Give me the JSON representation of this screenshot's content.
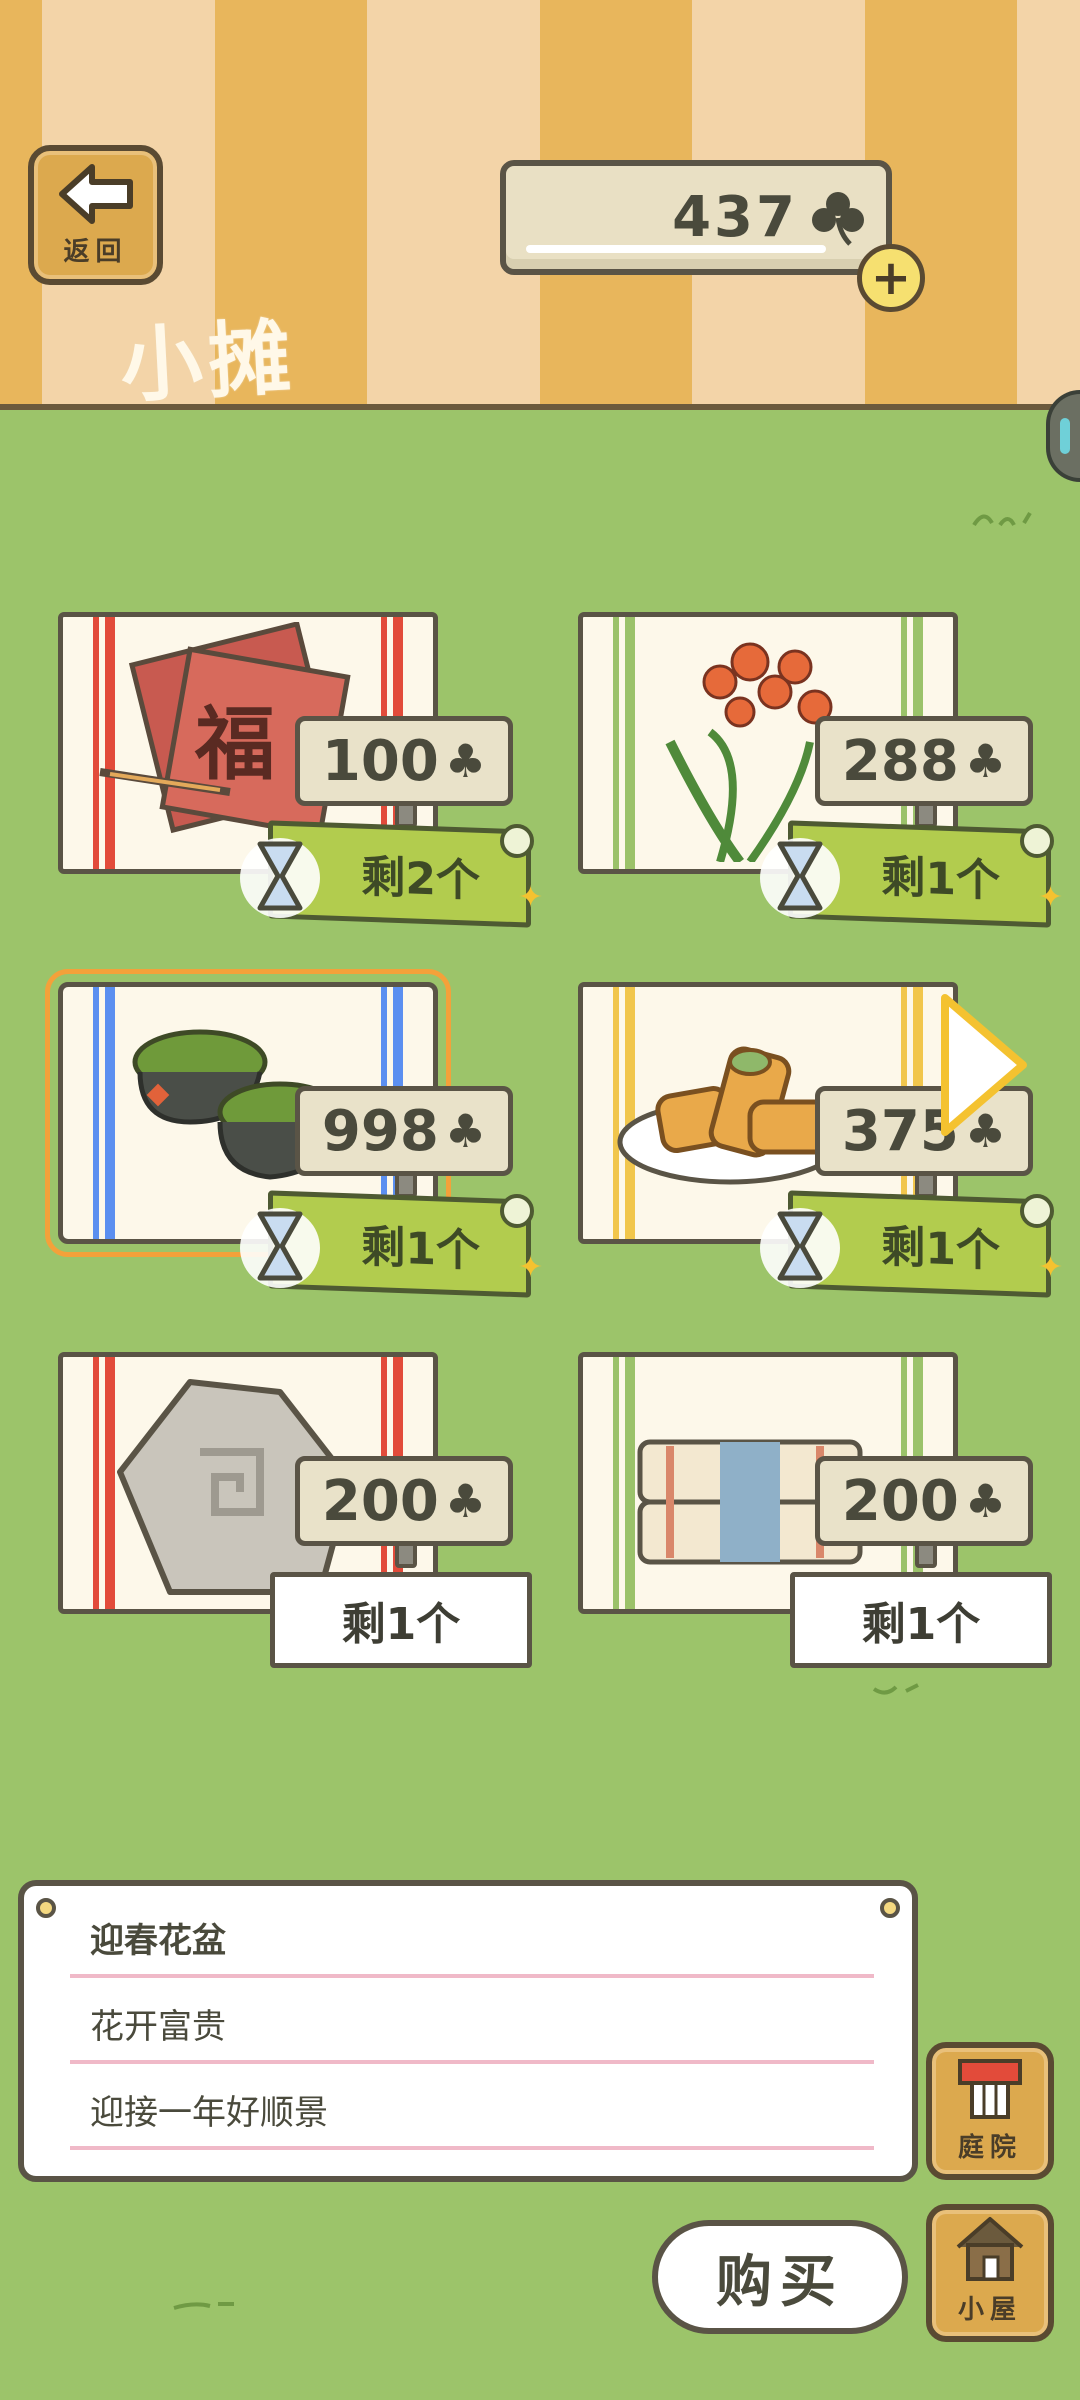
{
  "header": {
    "back_label": "返回",
    "title": "小摊",
    "clover_count": "437",
    "plus_symbol": "+"
  },
  "items": [
    {
      "name": "红纸对联",
      "price": "100",
      "stock": "剩2个",
      "timed": true,
      "stripe_color": "#e24b3a",
      "art": "red-paper-icon"
    },
    {
      "name": "君子兰",
      "price": "288",
      "stock": "剩1个",
      "timed": true,
      "stripe_color": "#9bc26a",
      "art": "orange-flower-icon"
    },
    {
      "name": "迎春花盆",
      "price": "998",
      "stock": "剩1个",
      "timed": true,
      "stripe_color": "#5b8ff0",
      "art": "grass-pot-icon",
      "selected": true
    },
    {
      "name": "春卷",
      "price": "375",
      "stock": "剩1个",
      "timed": true,
      "stripe_color": "#f1c64c",
      "art": "spring-roll-icon"
    },
    {
      "name": "石头",
      "price": "200",
      "stock": "剩1个",
      "timed": false,
      "stripe_color": "#e24b3a",
      "art": "stone-icon"
    },
    {
      "name": "布匹",
      "price": "200",
      "stock": "剩1个",
      "timed": false,
      "stripe_color": "#9bc26a",
      "art": "cloth-icon"
    }
  ],
  "currency_symbol": "♣",
  "description": {
    "title": "迎春花盆",
    "line1": "花开富贵",
    "line2": "迎接一年好顺景"
  },
  "buttons": {
    "yard_label": "庭院",
    "house_label": "小屋",
    "buy_label": "购买"
  },
  "colors": {
    "grass": "#9cc46a",
    "stripe_orange": "#e8b65c",
    "stripe_cream": "#f3d4a8",
    "selection": "#f4a13a",
    "stock_green": "#b2cc4e"
  }
}
